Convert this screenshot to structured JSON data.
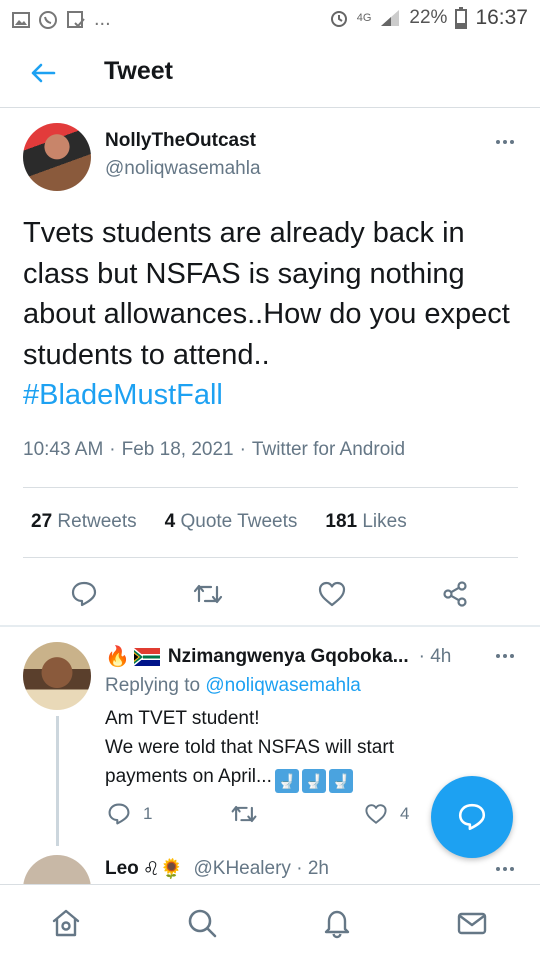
{
  "status_bar": {
    "time": "16:37",
    "battery_percent": "22%",
    "network": "4G"
  },
  "header": {
    "title": "Tweet"
  },
  "tweet": {
    "display_name": "NollyTheOutcast",
    "handle": "@noliqwasemahla",
    "text": "Tvets students are already back in class but NSFAS is saying nothing about allowances..How do you expect students to attend..",
    "hashtag": "#BladeMustFall",
    "time": "10:43 AM",
    "date": "Feb 18, 2021",
    "source": "Twitter for Android",
    "retweets_count": "27",
    "retweets_label": "Retweets",
    "quotes_count": "4",
    "quotes_label": "Quote Tweets",
    "likes_count": "181",
    "likes_label": "Likes"
  },
  "replies": [
    {
      "display_name": "Nzimangwenya Gqoboka...",
      "emoji": "🔥",
      "age": "4h",
      "replying_label": "Replying to",
      "replying_to": "@noliqwasemahla",
      "lines": [
        "Am TVET student!",
        "We were told that NSFAS will start",
        "payments on April..."
      ],
      "reply_count": "1",
      "like_count": "4"
    },
    {
      "display_name": "Leo",
      "emoji": "♌🌻",
      "handle": "@KHealery",
      "age": "2h"
    }
  ],
  "icons": {
    "back": "arrow-left-icon",
    "more": "more-dots-icon",
    "reply": "speech-bubble-icon",
    "retweet": "retweet-icon",
    "like": "heart-icon",
    "share": "share-icon",
    "compose": "compose-reply-icon",
    "nav": [
      "home-icon",
      "search-icon",
      "notifications-icon",
      "messages-icon"
    ]
  },
  "colors": {
    "accent": "#1da1f2",
    "text": "#14171a",
    "secondary": "#657786"
  }
}
